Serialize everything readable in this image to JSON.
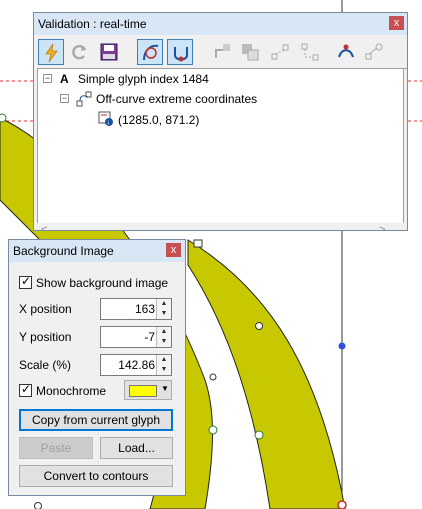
{
  "colors": {
    "glyph_fill": "#c8c800",
    "guide_red": "#e03030",
    "swatch": "#ffff00",
    "titlebar": "#d9e6f5",
    "close": "#c75050",
    "selected_tool": "#cce4f7"
  },
  "validation": {
    "title": "Validation : real-time",
    "close_glyph": "x",
    "toolbar_icons": [
      "lightning-icon",
      "refresh-icon",
      "save-report-icon",
      "check-off-curve-icon",
      "check-extrema-icon",
      "fix-direction-icon",
      "fix-overlap-icon",
      "fix-points-icon",
      "fix-handles-icon",
      "fix-smooth-icon"
    ],
    "tree": {
      "root": {
        "icon": "A",
        "label": "Simple glyph index 1484"
      },
      "child": {
        "label": "Off-curve extreme coordinates"
      },
      "leaf": {
        "label": "(1285.0, 871.2)"
      }
    },
    "scroll_left": "<",
    "scroll_right": ">"
  },
  "background_image": {
    "title": "Background Image",
    "close_glyph": "x",
    "show_label": "Show background image",
    "x_label": "X position",
    "x_value": "163",
    "y_label": "Y position",
    "y_value": "-7",
    "scale_label": "Scale (%)",
    "scale_value": "142.86",
    "mono_label": "Monochrome",
    "copy_label": "Copy from current glyph",
    "paste_label": "Paste",
    "load_label": "Load...",
    "convert_label": "Convert to contours"
  }
}
